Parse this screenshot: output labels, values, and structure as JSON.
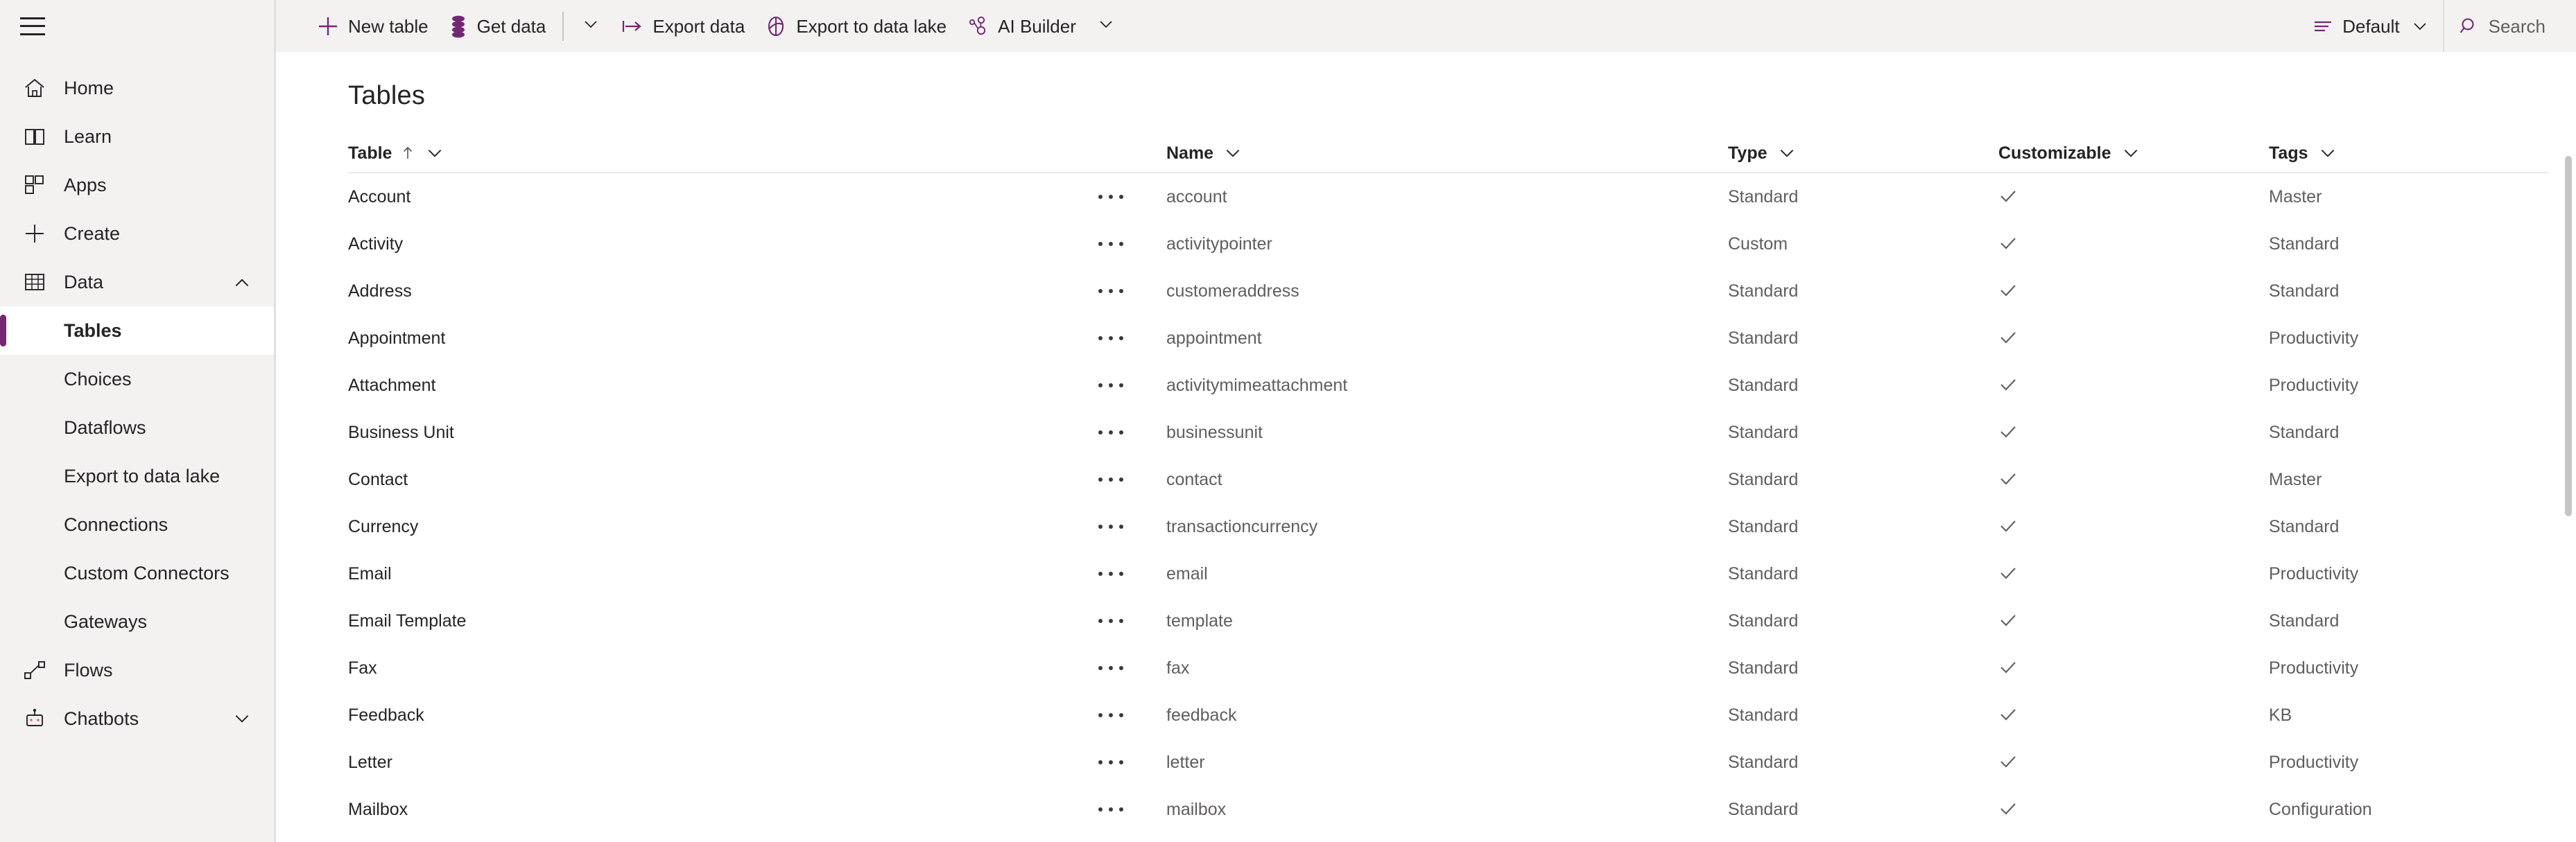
{
  "sidebar": {
    "menu_icon": "hamburger-icon",
    "items": [
      {
        "label": "Home",
        "icon": "home-icon",
        "type": "top",
        "selected": false,
        "chevron": ""
      },
      {
        "label": "Learn",
        "icon": "book-icon",
        "type": "top",
        "selected": false,
        "chevron": ""
      },
      {
        "label": "Apps",
        "icon": "apps-grid-icon",
        "type": "top",
        "selected": false,
        "chevron": ""
      },
      {
        "label": "Create",
        "icon": "plus-icon",
        "type": "top",
        "selected": false,
        "chevron": ""
      },
      {
        "label": "Data",
        "icon": "table-grid-icon",
        "type": "top",
        "selected": false,
        "chevron": "chevron-up-icon"
      },
      {
        "label": "Tables",
        "icon": "",
        "type": "sub",
        "selected": true,
        "chevron": ""
      },
      {
        "label": "Choices",
        "icon": "",
        "type": "sub",
        "selected": false,
        "chevron": ""
      },
      {
        "label": "Dataflows",
        "icon": "",
        "type": "sub",
        "selected": false,
        "chevron": ""
      },
      {
        "label": "Export to data lake",
        "icon": "",
        "type": "sub",
        "selected": false,
        "chevron": ""
      },
      {
        "label": "Connections",
        "icon": "",
        "type": "sub",
        "selected": false,
        "chevron": ""
      },
      {
        "label": "Custom Connectors",
        "icon": "",
        "type": "sub",
        "selected": false,
        "chevron": ""
      },
      {
        "label": "Gateways",
        "icon": "",
        "type": "sub",
        "selected": false,
        "chevron": ""
      },
      {
        "label": "Flows",
        "icon": "flow-icon",
        "type": "top",
        "selected": false,
        "chevron": ""
      },
      {
        "label": "Chatbots",
        "icon": "robot-icon",
        "type": "top",
        "selected": false,
        "chevron": "chevron-down-icon"
      }
    ]
  },
  "commandbar": {
    "buttons": [
      {
        "label": "New table",
        "icon": "plus-icon"
      },
      {
        "label": "Get data",
        "icon": "database-stack-icon"
      }
    ],
    "overflow_caret": "chevron-down-icon",
    "buttons2": [
      {
        "label": "Export data",
        "icon": "export-arrow-icon"
      },
      {
        "label": "Export to data lake",
        "icon": "data-lake-icon"
      },
      {
        "label": "AI Builder",
        "icon": "ai-builder-icon"
      }
    ],
    "ai_builder_caret": "chevron-down-icon",
    "view_selector": {
      "label": "Default",
      "icon": "view-lines-icon",
      "caret": "chevron-down-icon"
    },
    "search": {
      "label": "Search",
      "icon": "search-icon",
      "placeholder": "Search"
    }
  },
  "page": {
    "title": "Tables"
  },
  "grid": {
    "columns": [
      {
        "key": "table",
        "label": "Table",
        "sort": "ascending",
        "sort_icon": "arrow-up-icon",
        "chevron": "chevron-down-icon"
      },
      {
        "key": "name",
        "label": "Name",
        "sort": "",
        "sort_icon": "",
        "chevron": "chevron-down-icon"
      },
      {
        "key": "type",
        "label": "Type",
        "sort": "",
        "sort_icon": "",
        "chevron": "chevron-down-icon"
      },
      {
        "key": "customizable",
        "label": "Customizable",
        "sort": "",
        "sort_icon": "",
        "chevron": "chevron-down-icon"
      },
      {
        "key": "tags",
        "label": "Tags",
        "sort": "",
        "sort_icon": "",
        "chevron": "chevron-down-icon"
      }
    ],
    "row_menu_icon": "more-options-icon",
    "customizable_icon": "checkmark-icon",
    "rows": [
      {
        "table": "Account",
        "name": "account",
        "type": "Standard",
        "customizable": true,
        "tags": "Master"
      },
      {
        "table": "Activity",
        "name": "activitypointer",
        "type": "Custom",
        "customizable": true,
        "tags": "Standard"
      },
      {
        "table": "Address",
        "name": "customeraddress",
        "type": "Standard",
        "customizable": true,
        "tags": "Standard"
      },
      {
        "table": "Appointment",
        "name": "appointment",
        "type": "Standard",
        "customizable": true,
        "tags": "Productivity"
      },
      {
        "table": "Attachment",
        "name": "activitymimeattachment",
        "type": "Standard",
        "customizable": true,
        "tags": "Productivity"
      },
      {
        "table": "Business Unit",
        "name": "businessunit",
        "type": "Standard",
        "customizable": true,
        "tags": "Standard"
      },
      {
        "table": "Contact",
        "name": "contact",
        "type": "Standard",
        "customizable": true,
        "tags": "Master"
      },
      {
        "table": "Currency",
        "name": "transactioncurrency",
        "type": "Standard",
        "customizable": true,
        "tags": "Standard"
      },
      {
        "table": "Email",
        "name": "email",
        "type": "Standard",
        "customizable": true,
        "tags": "Productivity"
      },
      {
        "table": "Email Template",
        "name": "template",
        "type": "Standard",
        "customizable": true,
        "tags": "Standard"
      },
      {
        "table": "Fax",
        "name": "fax",
        "type": "Standard",
        "customizable": true,
        "tags": "Productivity"
      },
      {
        "table": "Feedback",
        "name": "feedback",
        "type": "Standard",
        "customizable": true,
        "tags": "KB"
      },
      {
        "table": "Letter",
        "name": "letter",
        "type": "Standard",
        "customizable": true,
        "tags": "Productivity"
      },
      {
        "table": "Mailbox",
        "name": "mailbox",
        "type": "Standard",
        "customizable": true,
        "tags": "Configuration"
      }
    ]
  },
  "colors": {
    "accent": "#742774",
    "sidebar_bg": "#f3f2f1",
    "content_bg": "#ffffff",
    "text_primary": "#242424",
    "text_secondary": "#605e5c",
    "divider": "#edebe9"
  }
}
